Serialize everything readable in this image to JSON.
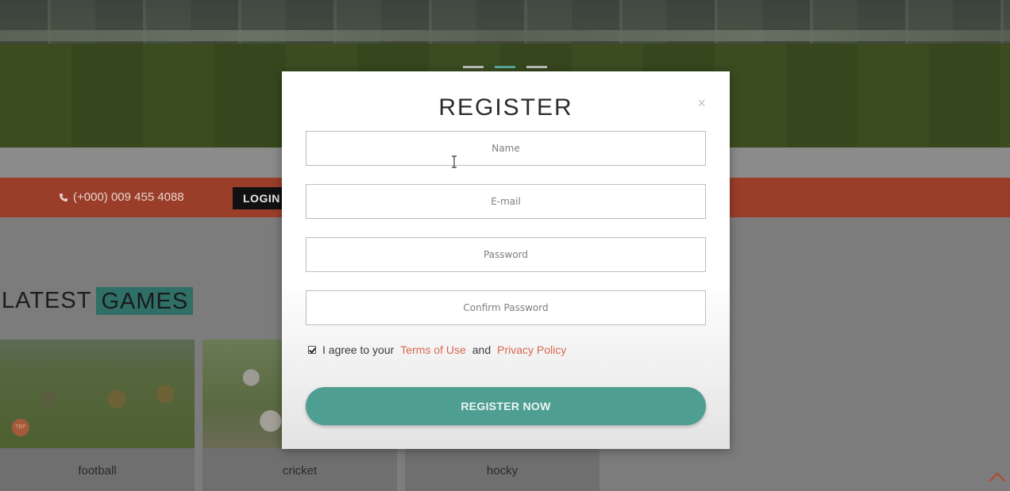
{
  "hero": {
    "slider_dots": [
      false,
      true,
      false
    ]
  },
  "topbar": {
    "phone": "(+000) 009 455 4088",
    "login_label": "LOGIN"
  },
  "latest": {
    "title_plain": "LATEST",
    "title_highlight": "GAMES"
  },
  "games": [
    {
      "label": "football"
    },
    {
      "label": "cricket"
    },
    {
      "label": "hocky"
    }
  ],
  "modal": {
    "title": "REGISTER",
    "close_glyph": "×",
    "fields": {
      "name_placeholder": "Name",
      "email_placeholder": "E-mail",
      "password_placeholder": "Password",
      "confirm_placeholder": "Confirm Password"
    },
    "agree": {
      "checked": true,
      "prefix": "I agree to your",
      "terms_link": "Terms of Use",
      "and": "and",
      "privacy_link": "Privacy Policy"
    },
    "submit_label": "REGISTER NOW"
  },
  "colors": {
    "accent_teal": "#4f9e92",
    "link_coral": "#d9674f",
    "topbar_red": "#9a3e2a"
  },
  "icons": {
    "phone": "phone-icon",
    "close": "close-icon",
    "scroll_top": "chevron-up-icon",
    "cursor": "text-cursor-icon"
  }
}
